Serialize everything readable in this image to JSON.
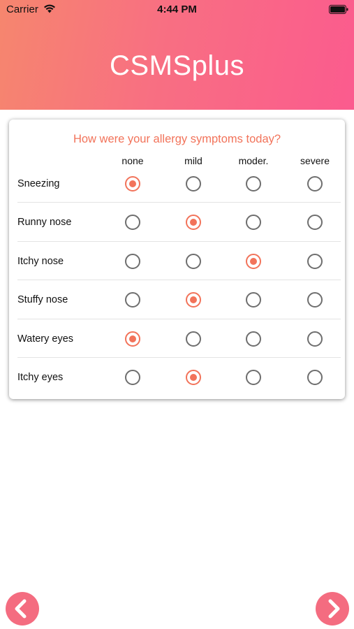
{
  "status_bar": {
    "carrier": "Carrier",
    "time": "4:44 PM"
  },
  "header": {
    "title": "CSMSplus"
  },
  "survey": {
    "question": "How were your allergy symptoms today?",
    "columns": [
      "none",
      "mild",
      "moder.",
      "severe"
    ],
    "rows": [
      {
        "label": "Sneezing",
        "selected": "none"
      },
      {
        "label": "Runny nose",
        "selected": "mild"
      },
      {
        "label": "Itchy nose",
        "selected": "moder."
      },
      {
        "label": "Stuffy nose",
        "selected": "mild"
      },
      {
        "label": "Watery eyes",
        "selected": "none"
      },
      {
        "label": "Itchy eyes",
        "selected": "mild"
      }
    ]
  },
  "nav": {
    "prev_icon": "chevron-left-icon",
    "next_icon": "chevron-right-icon"
  },
  "colors": {
    "accent": "#f2735a",
    "header_gradient_start": "#f6866e",
    "header_gradient_end": "#fb5b8e",
    "nav_button": "#f46c80"
  }
}
